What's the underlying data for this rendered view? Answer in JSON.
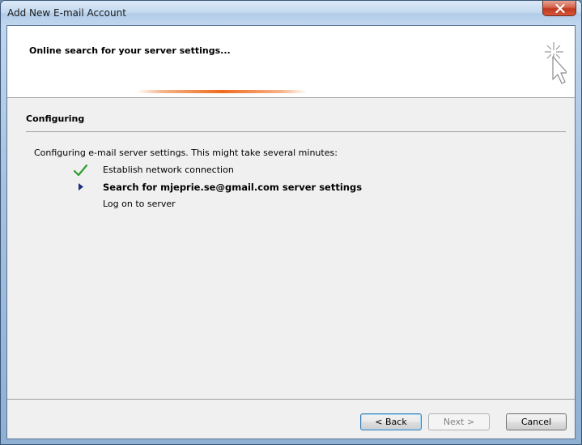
{
  "window": {
    "title": "Add New E-mail Account"
  },
  "header": {
    "title": "Online search for your server settings..."
  },
  "section": {
    "title": "Configuring",
    "intro": "Configuring e-mail server settings. This might take several minutes:"
  },
  "steps": [
    {
      "label": "Establish network connection",
      "state": "done",
      "icon": "checkmark-icon"
    },
    {
      "label": "Search for mjeprie.se@gmail.com server settings",
      "state": "active",
      "icon": "arrow-right-icon"
    },
    {
      "label": "Log on to server",
      "state": "pending"
    }
  ],
  "buttons": {
    "back": "< Back",
    "next": "Next >",
    "cancel": "Cancel"
  },
  "colors": {
    "check": "#2e9e2e",
    "arrow": "#1f2f7a",
    "progress": "#f06a1e",
    "close": "#c0391f"
  }
}
